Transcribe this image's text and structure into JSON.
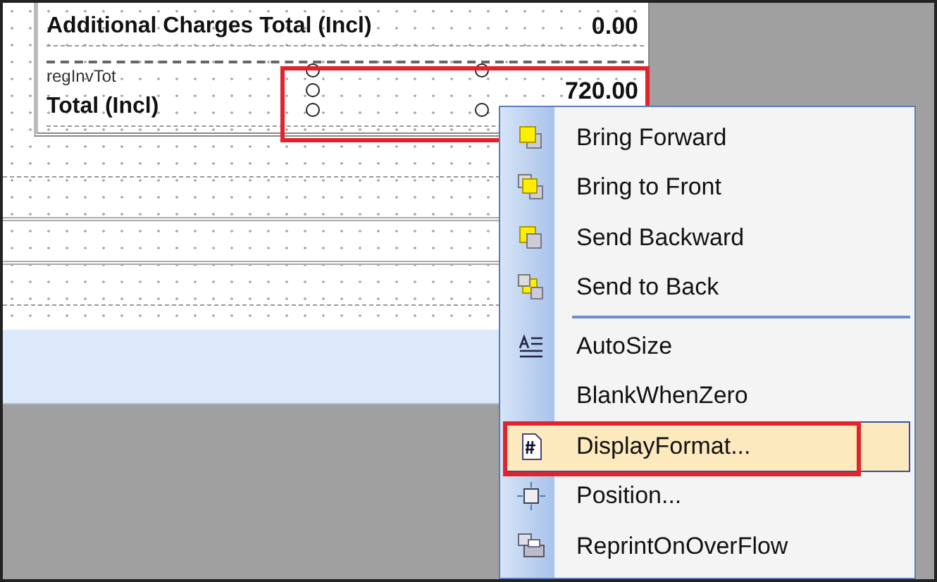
{
  "report": {
    "rows": [
      {
        "label": "Additional Charges Total (Incl)",
        "value": "0.00",
        "field_name": "",
        "selected": false
      },
      {
        "label": "Total (Incl)",
        "value": "720.00",
        "field_name": "regInvTot",
        "selected": true
      }
    ]
  },
  "context_menu": {
    "items": [
      {
        "kind": "item",
        "label": "Bring Forward",
        "selected": false
      },
      {
        "kind": "item",
        "label": "Bring to Front",
        "selected": false
      },
      {
        "kind": "item",
        "label": "Send Backward",
        "selected": false
      },
      {
        "kind": "item",
        "label": "Send to Back",
        "selected": false
      },
      {
        "kind": "separator"
      },
      {
        "kind": "item",
        "label": "AutoSize",
        "selected": false
      },
      {
        "kind": "item",
        "label": "BlankWhenZero",
        "selected": false
      },
      {
        "kind": "item",
        "label": "DisplayFormat...",
        "selected": true
      },
      {
        "kind": "item",
        "label": "Position...",
        "selected": false
      },
      {
        "kind": "item",
        "label": "ReprintOnOverFlow",
        "selected": false
      }
    ]
  }
}
